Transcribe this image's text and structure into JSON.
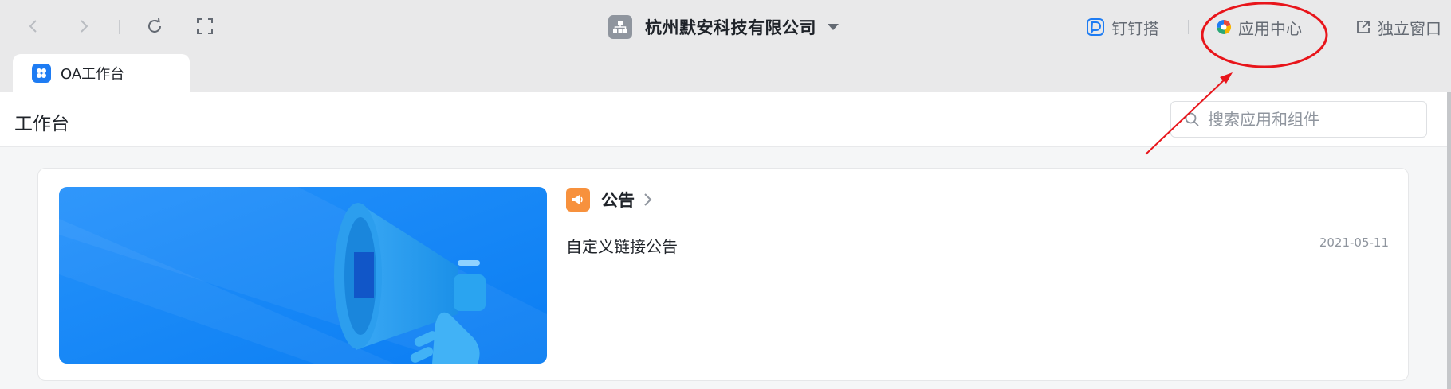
{
  "toolbar": {
    "org_name": "杭州默安科技有限公司",
    "dingtalk_label": "钉钉搭",
    "app_center_label": "应用中心",
    "standalone_label": "独立窗口"
  },
  "tab": {
    "label": "OA工作台"
  },
  "workspace": {
    "title": "工作台",
    "search_placeholder": "搜索应用和组件"
  },
  "announcement": {
    "title": "公告",
    "items": [
      {
        "text": "自定义链接公告",
        "date": "2021-05-11"
      }
    ]
  },
  "colors": {
    "accent": "#1e7cf3",
    "banner": "#1787f8",
    "notice_icon": "#f7913d",
    "annotation": "#e8151b"
  },
  "icons": [
    "back-icon",
    "forward-icon",
    "refresh-icon",
    "fullscreen-icon",
    "org-icon",
    "dingtalk-icon",
    "app-center-icon",
    "external-window-icon",
    "search-icon",
    "megaphone-icon",
    "chevron-right-icon"
  ]
}
